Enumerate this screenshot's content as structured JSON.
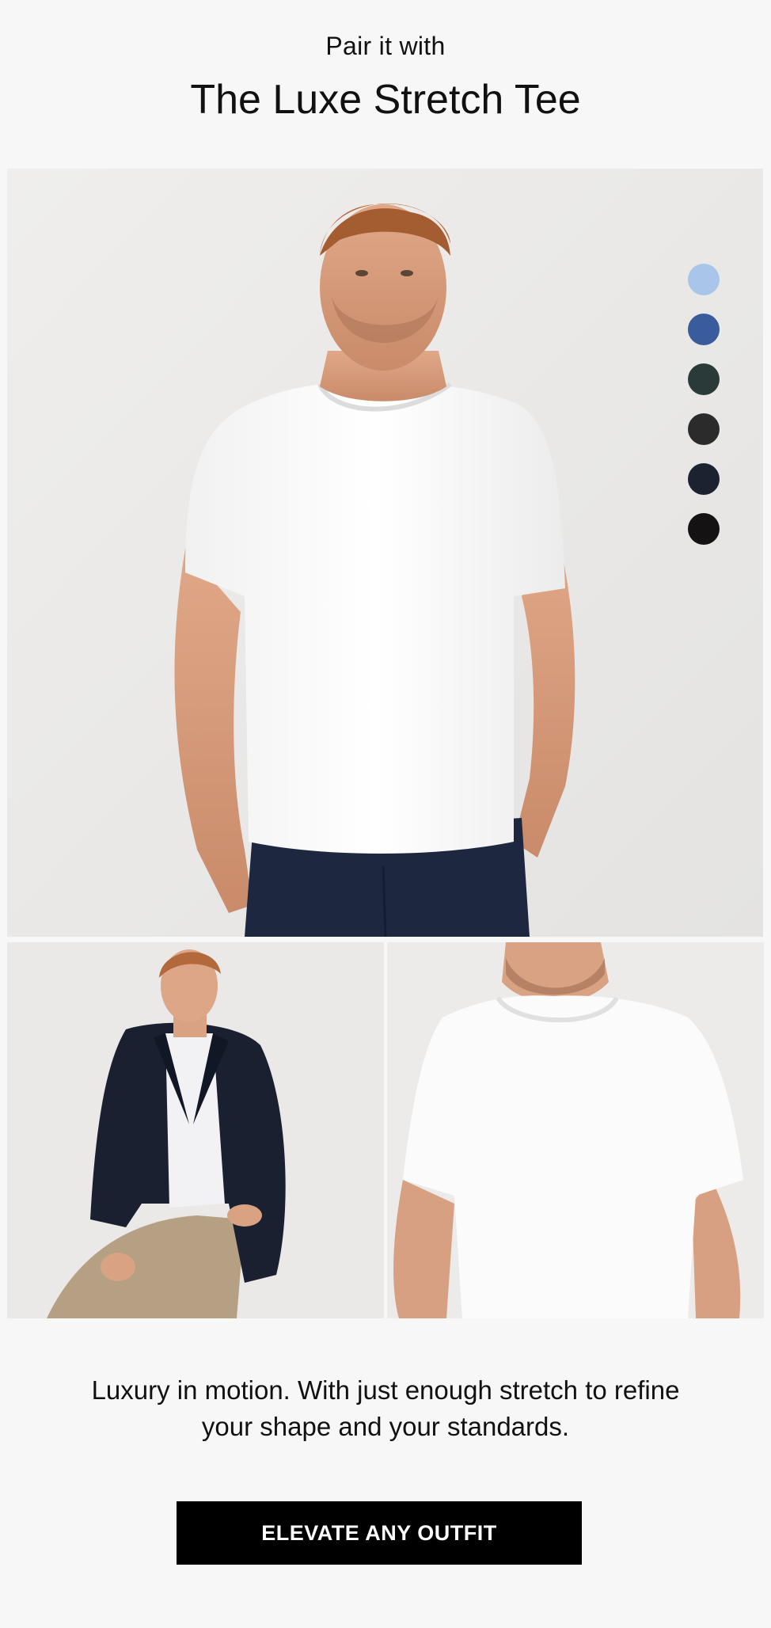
{
  "header": {
    "eyebrow": "Pair it with",
    "title": "The Luxe Stretch Tee"
  },
  "hero": {
    "image": "model-front-white-tee",
    "swatches": [
      {
        "name": "light-blue",
        "color": "#a9c6ea"
      },
      {
        "name": "blue",
        "color": "#3a5b9c"
      },
      {
        "name": "dark-green",
        "color": "#2a3a38"
      },
      {
        "name": "charcoal",
        "color": "#2b2b2b"
      },
      {
        "name": "navy",
        "color": "#1c2230"
      },
      {
        "name": "black",
        "color": "#141212"
      }
    ]
  },
  "gallery": [
    {
      "image": "model-seated-navy-blazer"
    },
    {
      "image": "closeup-white-tee"
    }
  ],
  "copy": {
    "body": "Luxury in motion. With just enough stretch to refine your shape and your standards."
  },
  "cta": {
    "label": "ELEVATE ANY OUTFIT",
    "color": "#000000"
  }
}
